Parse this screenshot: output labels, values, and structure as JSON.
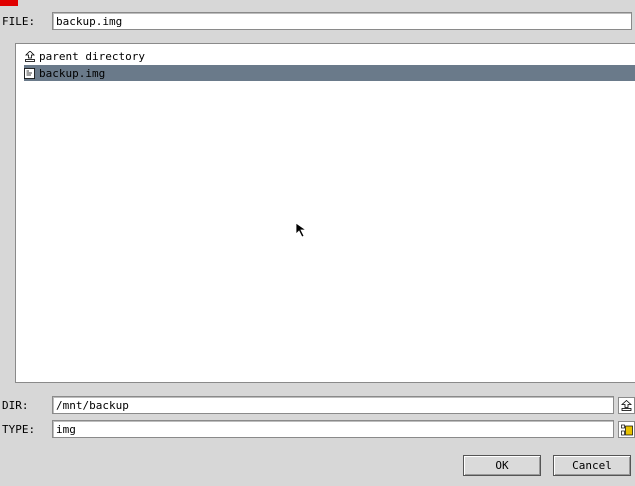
{
  "file": {
    "label": "FILE:",
    "value": "backup.img"
  },
  "list": {
    "items": [
      {
        "label": "parent directory",
        "icon": "parent-directory-icon",
        "selected": false
      },
      {
        "label": "backup.img",
        "icon": "file-icon",
        "selected": true
      }
    ]
  },
  "dir": {
    "label": "DIR:",
    "value": "/mnt/backup"
  },
  "type": {
    "label": "TYPE:",
    "value": "img"
  },
  "actions": {
    "ok": "OK",
    "cancel": "Cancel"
  },
  "colors": {
    "selection": "#6a7a8a",
    "background": "#d7d7d7",
    "accent_red": "#e00000"
  }
}
